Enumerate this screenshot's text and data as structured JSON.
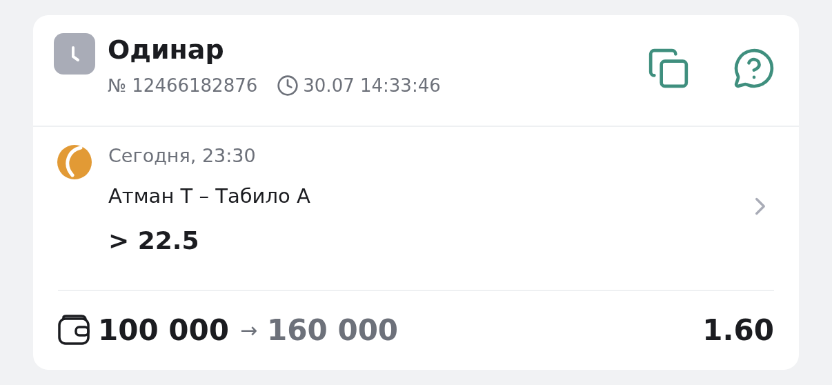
{
  "bet": {
    "type": "Одинар",
    "number": "№ 12466182876",
    "created": "30.07 14:33:46"
  },
  "event": {
    "date": "Сегодня, 23:30",
    "teams": "Атман Т – Табило А",
    "outcome": "> 22.5"
  },
  "footer": {
    "stake": "100 000",
    "arrow": "→",
    "payout": "160 000",
    "odds": "1.60"
  }
}
